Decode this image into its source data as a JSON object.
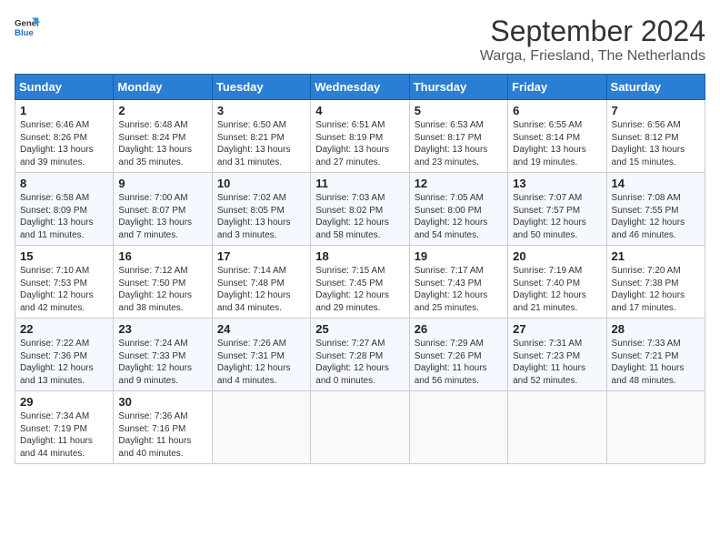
{
  "logo": {
    "line1": "General",
    "line2": "Blue"
  },
  "title": "September 2024",
  "subtitle": "Warga, Friesland, The Netherlands",
  "header_days": [
    "Sunday",
    "Monday",
    "Tuesday",
    "Wednesday",
    "Thursday",
    "Friday",
    "Saturday"
  ],
  "weeks": [
    [
      {
        "day": "1",
        "info": "Sunrise: 6:46 AM\nSunset: 8:26 PM\nDaylight: 13 hours\nand 39 minutes."
      },
      {
        "day": "2",
        "info": "Sunrise: 6:48 AM\nSunset: 8:24 PM\nDaylight: 13 hours\nand 35 minutes."
      },
      {
        "day": "3",
        "info": "Sunrise: 6:50 AM\nSunset: 8:21 PM\nDaylight: 13 hours\nand 31 minutes."
      },
      {
        "day": "4",
        "info": "Sunrise: 6:51 AM\nSunset: 8:19 PM\nDaylight: 13 hours\nand 27 minutes."
      },
      {
        "day": "5",
        "info": "Sunrise: 6:53 AM\nSunset: 8:17 PM\nDaylight: 13 hours\nand 23 minutes."
      },
      {
        "day": "6",
        "info": "Sunrise: 6:55 AM\nSunset: 8:14 PM\nDaylight: 13 hours\nand 19 minutes."
      },
      {
        "day": "7",
        "info": "Sunrise: 6:56 AM\nSunset: 8:12 PM\nDaylight: 13 hours\nand 15 minutes."
      }
    ],
    [
      {
        "day": "8",
        "info": "Sunrise: 6:58 AM\nSunset: 8:09 PM\nDaylight: 13 hours\nand 11 minutes."
      },
      {
        "day": "9",
        "info": "Sunrise: 7:00 AM\nSunset: 8:07 PM\nDaylight: 13 hours\nand 7 minutes."
      },
      {
        "day": "10",
        "info": "Sunrise: 7:02 AM\nSunset: 8:05 PM\nDaylight: 13 hours\nand 3 minutes."
      },
      {
        "day": "11",
        "info": "Sunrise: 7:03 AM\nSunset: 8:02 PM\nDaylight: 12 hours\nand 58 minutes."
      },
      {
        "day": "12",
        "info": "Sunrise: 7:05 AM\nSunset: 8:00 PM\nDaylight: 12 hours\nand 54 minutes."
      },
      {
        "day": "13",
        "info": "Sunrise: 7:07 AM\nSunset: 7:57 PM\nDaylight: 12 hours\nand 50 minutes."
      },
      {
        "day": "14",
        "info": "Sunrise: 7:08 AM\nSunset: 7:55 PM\nDaylight: 12 hours\nand 46 minutes."
      }
    ],
    [
      {
        "day": "15",
        "info": "Sunrise: 7:10 AM\nSunset: 7:53 PM\nDaylight: 12 hours\nand 42 minutes."
      },
      {
        "day": "16",
        "info": "Sunrise: 7:12 AM\nSunset: 7:50 PM\nDaylight: 12 hours\nand 38 minutes."
      },
      {
        "day": "17",
        "info": "Sunrise: 7:14 AM\nSunset: 7:48 PM\nDaylight: 12 hours\nand 34 minutes."
      },
      {
        "day": "18",
        "info": "Sunrise: 7:15 AM\nSunset: 7:45 PM\nDaylight: 12 hours\nand 29 minutes."
      },
      {
        "day": "19",
        "info": "Sunrise: 7:17 AM\nSunset: 7:43 PM\nDaylight: 12 hours\nand 25 minutes."
      },
      {
        "day": "20",
        "info": "Sunrise: 7:19 AM\nSunset: 7:40 PM\nDaylight: 12 hours\nand 21 minutes."
      },
      {
        "day": "21",
        "info": "Sunrise: 7:20 AM\nSunset: 7:38 PM\nDaylight: 12 hours\nand 17 minutes."
      }
    ],
    [
      {
        "day": "22",
        "info": "Sunrise: 7:22 AM\nSunset: 7:36 PM\nDaylight: 12 hours\nand 13 minutes."
      },
      {
        "day": "23",
        "info": "Sunrise: 7:24 AM\nSunset: 7:33 PM\nDaylight: 12 hours\nand 9 minutes."
      },
      {
        "day": "24",
        "info": "Sunrise: 7:26 AM\nSunset: 7:31 PM\nDaylight: 12 hours\nand 4 minutes."
      },
      {
        "day": "25",
        "info": "Sunrise: 7:27 AM\nSunset: 7:28 PM\nDaylight: 12 hours\nand 0 minutes."
      },
      {
        "day": "26",
        "info": "Sunrise: 7:29 AM\nSunset: 7:26 PM\nDaylight: 11 hours\nand 56 minutes."
      },
      {
        "day": "27",
        "info": "Sunrise: 7:31 AM\nSunset: 7:23 PM\nDaylight: 11 hours\nand 52 minutes."
      },
      {
        "day": "28",
        "info": "Sunrise: 7:33 AM\nSunset: 7:21 PM\nDaylight: 11 hours\nand 48 minutes."
      }
    ],
    [
      {
        "day": "29",
        "info": "Sunrise: 7:34 AM\nSunset: 7:19 PM\nDaylight: 11 hours\nand 44 minutes."
      },
      {
        "day": "30",
        "info": "Sunrise: 7:36 AM\nSunset: 7:16 PM\nDaylight: 11 hours\nand 40 minutes."
      },
      {
        "day": "",
        "info": ""
      },
      {
        "day": "",
        "info": ""
      },
      {
        "day": "",
        "info": ""
      },
      {
        "day": "",
        "info": ""
      },
      {
        "day": "",
        "info": ""
      }
    ]
  ]
}
